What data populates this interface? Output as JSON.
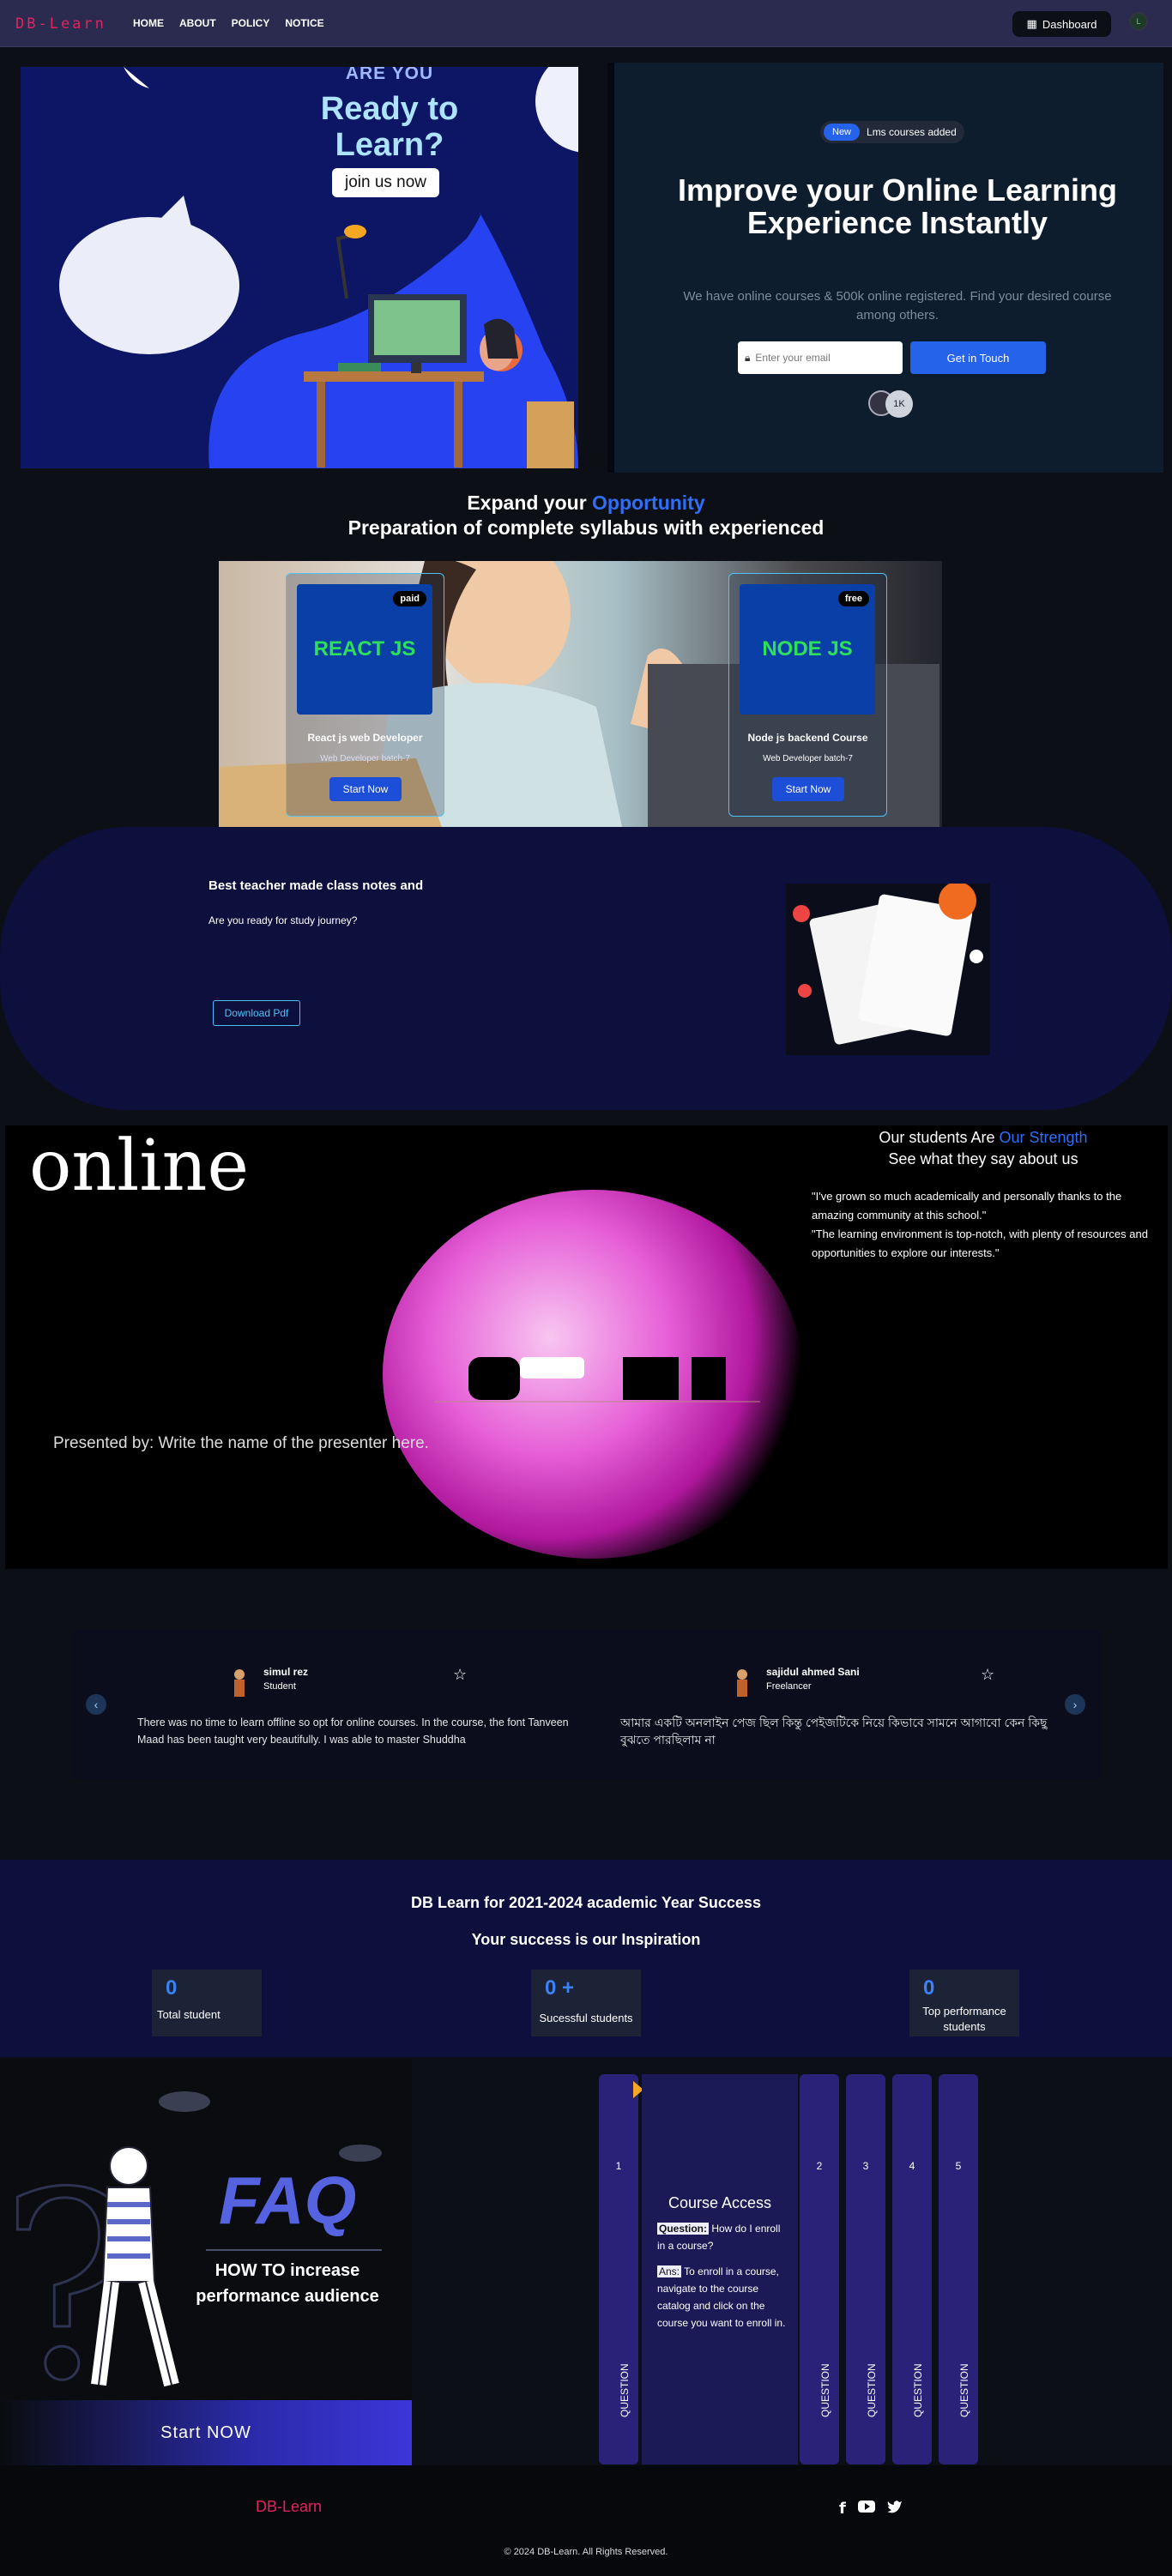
{
  "nav": {
    "logo": "DB-Learn",
    "links": [
      "HOME",
      "ABOUT",
      "POLICY",
      "NOTICE"
    ],
    "dashboard_label": "Dashboard"
  },
  "hero": {
    "banner": {
      "line1": "ARE YOU",
      "line2": "Ready to",
      "line3": "Learn?",
      "cta": "join us now"
    },
    "badge_new": "New",
    "badge_text": "Lms courses added",
    "title": "Improve your Online Learning Experience Instantly",
    "subtitle": "We have online courses & 500k online registered. Find your desired course among others.",
    "email_placeholder": "Enter your email",
    "button": "Get in Touch",
    "avatar_count": "1K"
  },
  "opportunity": {
    "title_prefix": "Expand your",
    "title_highlight": "Opportunity",
    "title_line2": "Preparation of complete syllabus with experienced"
  },
  "courses": [
    {
      "logo": "REACT JS",
      "tag": "paid",
      "name": "React js web Developer",
      "batch": "Web Developer batch-7",
      "button": "Start Now"
    },
    {
      "logo": "NODE JS",
      "tag": "free",
      "name": "Node js backend Course",
      "batch": "Web Developer batch-7",
      "button": "Start Now"
    }
  ],
  "notes": {
    "title": "Best teacher made class notes and",
    "subtitle": "Are you ready for study journey?",
    "button": "Download Pdf"
  },
  "strength": {
    "slide_word": "online",
    "presenter": "Presented by: Write the name of the presenter here.",
    "title_prefix": "Our students Are",
    "title_highlight": "Our Strength",
    "title_line2": "See what they say about us",
    "quotes": [
      "\"I've grown so much academically and personally thanks to the amazing community at this school.\"",
      "\"The learning environment is top-notch, with plenty of resources and opportunities to explore our interests.\""
    ]
  },
  "reviews": [
    {
      "name": "simul rez",
      "role": "Student",
      "text": "There was no time to learn offline so opt for online courses. In the course, the font Tanveen Maad has been taught very beautifully. I was able to master Shuddha"
    },
    {
      "name": "sajidul ahmed Sani",
      "role": "Freelancer",
      "text": "আমার একটি অনলাইন পেজ ছিল কিন্তু পেইজটিকে নিয়ে কিভাবে সামনে আগাবো কেন কিছু বুঝতে পারছিলাম না"
    }
  ],
  "success": {
    "title": "DB Learn for 2021-2024 academic Year Success",
    "subtitle": "Your success is our Inspiration",
    "stats": [
      {
        "value": "0",
        "label": "Total student"
      },
      {
        "value": "0 +",
        "label": "Sucessful students"
      },
      {
        "value": "0",
        "label": "Top performance students"
      }
    ]
  },
  "faq": {
    "word": "FAQ",
    "heading": "HOW TO increase performance audience",
    "button": "Start NOW",
    "open_title": "Course Access",
    "open_question_label": "Question:",
    "open_question": "How do I enroll in a course?",
    "open_answer_label": "Ans:",
    "open_answer": "To enroll in a course, navigate to the course catalog and click on the course you want to enroll in.",
    "tabs": [
      {
        "num": "1",
        "label": "QUESTION"
      },
      {
        "num": "2",
        "label": "QUESTION"
      },
      {
        "num": "3",
        "label": "QUESTION"
      },
      {
        "num": "4",
        "label": "QUESTION"
      },
      {
        "num": "5",
        "label": "QUESTION"
      }
    ]
  },
  "footer": {
    "logo": "DB-Learn",
    "social": [
      "facebook-icon",
      "youtube-icon",
      "twitter-icon"
    ],
    "copyright": "© 2024 DB-Learn. All Rights Reserved."
  },
  "colors": {
    "accent": "#2563eb",
    "brand": "#e0245e",
    "navy": "#0d0f3c"
  }
}
